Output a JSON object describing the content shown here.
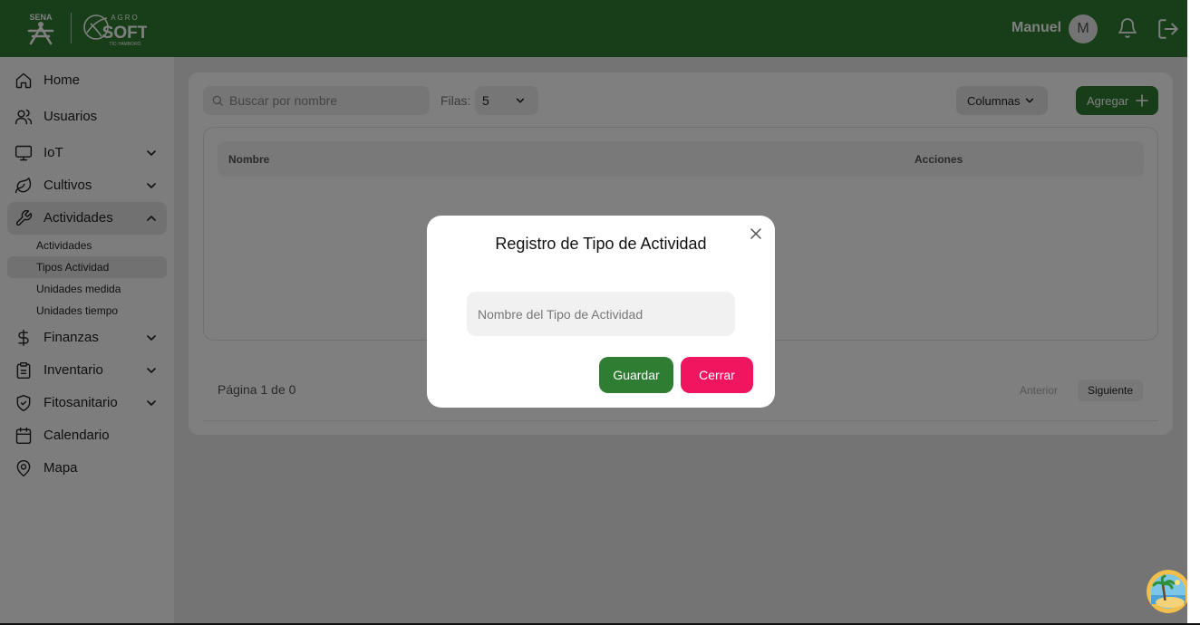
{
  "header": {
    "user_name": "Manuel",
    "avatar_initial": "M",
    "logo_sena_text": "SENA",
    "logo_agro_top": "AGRO",
    "logo_agro_main": "SOFT",
    "logo_agro_sub": "TIC-YAMBORÓ"
  },
  "sidebar": {
    "items": [
      {
        "label": "Home",
        "icon": "home-icon"
      },
      {
        "label": "Usuarios",
        "icon": "users-icon"
      },
      {
        "label": "IoT",
        "icon": "monitor-icon"
      },
      {
        "label": "Cultivos",
        "icon": "leaf-icon"
      },
      {
        "label": "Actividades",
        "icon": "wrench-icon"
      },
      {
        "label": "Finanzas",
        "icon": "dollar-icon"
      },
      {
        "label": "Inventario",
        "icon": "clipboard-icon"
      },
      {
        "label": "Fitosanitario",
        "icon": "shield-icon"
      },
      {
        "label": "Calendario",
        "icon": "calendar-icon"
      },
      {
        "label": "Mapa",
        "icon": "map-pin-icon"
      }
    ],
    "subitems": [
      {
        "label": "Actividades"
      },
      {
        "label": "Tipos Actividad"
      },
      {
        "label": "Unidades medida"
      },
      {
        "label": "Unidades tiempo"
      }
    ]
  },
  "toolbar": {
    "search_placeholder": "Buscar por nombre",
    "rows_label": "Filas:",
    "rows_value": "5",
    "columns_label": "Columnas",
    "add_label": "Agregar"
  },
  "table": {
    "columns": [
      "Nombre",
      "Acciones"
    ]
  },
  "pagination": {
    "info": "Página 1 de 0",
    "prev": "Anterior",
    "next": "Siguiente"
  },
  "modal": {
    "title": "Registro de Tipo de Actividad",
    "input_placeholder": "Nombre del Tipo de Actividad",
    "save_label": "Guardar",
    "close_label": "Cerrar"
  },
  "colors": {
    "brand_green": "#2e7d32",
    "danger_pink": "#f0155f"
  }
}
